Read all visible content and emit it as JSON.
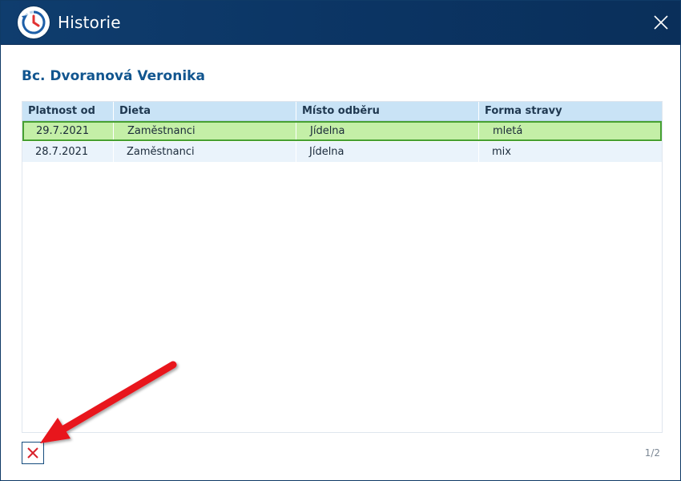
{
  "window": {
    "title": "Historie",
    "app_icon": "history-clock-icon",
    "close_icon": "close-icon"
  },
  "person": {
    "name": "Bc. Dvoranová Veronika"
  },
  "table": {
    "columns": [
      "Platnost od",
      "Dieta",
      "Místo odběru",
      "Forma stravy"
    ],
    "rows": [
      {
        "platnost_od": "29.7.2021",
        "dieta": "Zaměstnanci",
        "misto_odberu": "Jídelna",
        "forma_stravy": "mletá",
        "selected": true
      },
      {
        "platnost_od": "28.7.2021",
        "dieta": "Zaměstnanci",
        "misto_odberu": "Jídelna",
        "forma_stravy": "mix",
        "selected": false
      }
    ]
  },
  "footer": {
    "close_icon": "close-x-icon",
    "pager": "1/2"
  },
  "annotation": {
    "arrow_color": "#e8121e"
  },
  "colors": {
    "titlebar": "#0f3d6e",
    "header_bg": "#c9e3f6",
    "selected_row": "#c4efa7",
    "selected_border": "#47a032",
    "name_color": "#11558f"
  }
}
